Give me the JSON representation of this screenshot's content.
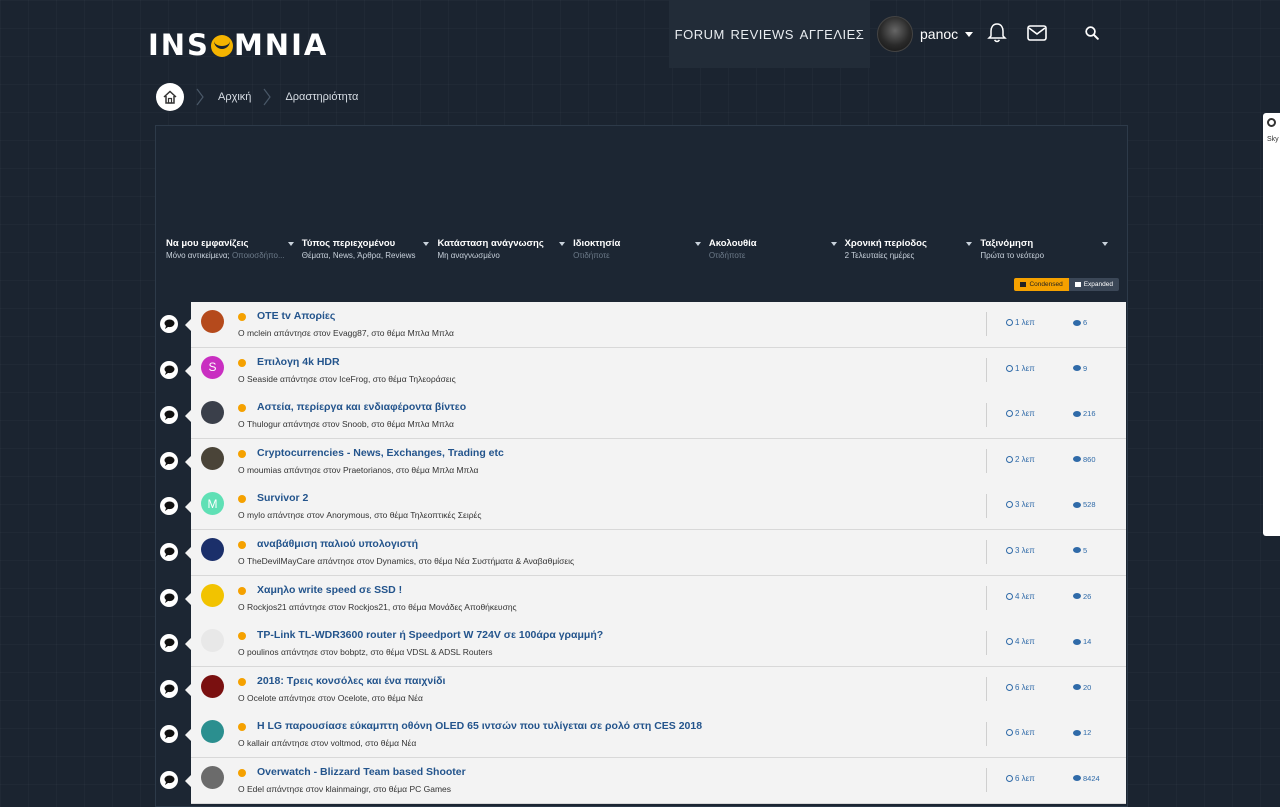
{
  "header": {
    "logo": "INSOMNIA",
    "nav": [
      "FORUM",
      "REVIEWS",
      "ΑΓΓΕΛΙΕΣ"
    ],
    "user": "panoc"
  },
  "breadcrumb": [
    "Αρχική",
    "Δραστηριότητα"
  ],
  "filters": [
    {
      "title": "Να μου εμφανίζεις",
      "value": "Μόνο αντικείμενα;",
      "muted": "Οποιοσδήπο..."
    },
    {
      "title": "Τύπος περιεχομένου",
      "value": "Θέματα, News, Άρθρα, Reviews",
      "muted": ""
    },
    {
      "title": "Κατάσταση ανάγνωσης",
      "value": "Μη αναγνωσμένο",
      "muted": ""
    },
    {
      "title": "Ιδιοκτησία",
      "value": "",
      "muted": "Οτιδήποτε"
    },
    {
      "title": "Ακολουθία",
      "value": "",
      "muted": "Οτιδήποτε"
    },
    {
      "title": "Χρονική περίοδος",
      "value": "2 Τελευταίες ημέρες",
      "muted": ""
    },
    {
      "title": "Ταξινόμηση",
      "value": "Πρώτα το νεότερο",
      "muted": ""
    }
  ],
  "view_toggle": {
    "condensed": "Condensed",
    "expanded": "Expanded"
  },
  "items": [
    {
      "title": "OTE tv Απορίες",
      "sub": "Ο mclein απάντησε στον Evagg87, στο θέμα Μπλα Μπλα",
      "time": "1 λεπ",
      "replies": "6",
      "avatar_color": "#b54a1c",
      "letter": ""
    },
    {
      "title": "Επιλογη 4k HDR",
      "sub": "Ο Seaside απάντησε στον IceFrog, στο θέμα Τηλεοράσεις",
      "time": "1 λεπ",
      "replies": "9",
      "avatar_color": "#c92fc1",
      "letter": "S"
    },
    {
      "title": "Αστεία, περίεργα και ενδιαφέροντα βίντεο",
      "sub": "Ο Thulogur απάντησε στον Snoob, στο θέμα Μπλα Μπλα",
      "time": "2 λεπ",
      "replies": "216",
      "avatar_color": "#3a3f4a",
      "letter": ""
    },
    {
      "title": "Cryptocurrencies - News, Exchanges, Trading etc",
      "sub": "Ο moumias απάντησε στον Praetorianos, στο θέμα Μπλα Μπλα",
      "time": "2 λεπ",
      "replies": "860",
      "avatar_color": "#4a4438",
      "letter": ""
    },
    {
      "title": "Survivor 2",
      "sub": "Ο mylo απάντησε στον Anorymous, στο θέμα Τηλεοπτικές Σειρές",
      "time": "3 λεπ",
      "replies": "528",
      "avatar_color": "#5fe0b5",
      "letter": "M"
    },
    {
      "title": "αναβάθμιση παλιού υπολογιστή",
      "sub": "Ο TheDevilMayCare απάντησε στον Dynamics, στο θέμα Νέα Συστήματα & Αναβαθμίσεις",
      "time": "3 λεπ",
      "replies": "5",
      "avatar_color": "#1b2f6a",
      "letter": ""
    },
    {
      "title": "Χαμηλο write speed σε SSD !",
      "sub": "Ο Rockjos21 απάντησε στον Rockjos21, στο θέμα Μονάδες Αποθήκευσης",
      "time": "4 λεπ",
      "replies": "26",
      "avatar_color": "#f2c300",
      "letter": ""
    },
    {
      "title": "TP-Link TL-WDR3600 router ή Speedport W 724V σε 100άρα γραμμή?",
      "sub": "Ο poulinos απάντησε στον bobptz, στο θέμα VDSL & ADSL Routers",
      "time": "4 λεπ",
      "replies": "14",
      "avatar_color": "#e8e8e8",
      "letter": ""
    },
    {
      "title": "2018: Τρεις κονσόλες και ένα παιχνίδι",
      "sub": "Ο Ocelote απάντησε στον Ocelote, στο θέμα Νέα",
      "time": "6 λεπ",
      "replies": "20",
      "avatar_color": "#7a1010",
      "letter": ""
    },
    {
      "title": "H LG παρουσίασε εύκαμπτη οθόνη OLED 65 ιντσών που τυλίγεται σε ρολό στη CES 2018",
      "sub": "Ο kallair απάντησε στον voltmod, στο θέμα Νέα",
      "time": "6 λεπ",
      "replies": "12",
      "avatar_color": "#2b8f8f",
      "letter": ""
    },
    {
      "title": "Overwatch - Blizzard Team based Shooter",
      "sub": "Ο Edel απάντησε στον klainmaingr, στο θέμα PC Games",
      "time": "6 λεπ",
      "replies": "8424",
      "avatar_color": "#6b6b6b",
      "letter": ""
    }
  ],
  "side_widget": {
    "label": "Sky"
  },
  "colors": {
    "accent": "#f5a100",
    "link": "#23548c",
    "bg": "#1b2430"
  }
}
